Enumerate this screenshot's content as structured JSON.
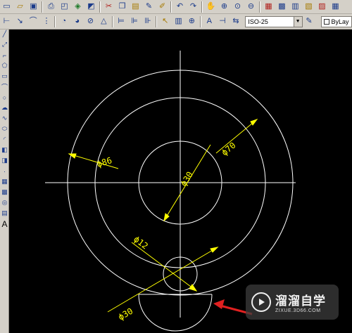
{
  "toolbar_top": {
    "icons": [
      "new-icon",
      "open-icon",
      "save-icon",
      "print-icon",
      "preview-icon",
      "publish-icon",
      "plot-icon",
      "cut-icon",
      "copy-icon",
      "paste-icon",
      "match-prop-icon",
      "block-editor-icon",
      "undo-icon",
      "redo-icon",
      "pan-icon",
      "zoom-realtime-icon",
      "zoom-window-icon",
      "zoom-previous-icon",
      "properties-icon",
      "design-center-icon",
      "tool-palettes-icon",
      "sheet-set-icon",
      "markup-icon",
      "calculator-icon"
    ]
  },
  "toolbar_dim": {
    "icons": [
      "linear-dim-icon",
      "aligned-dim-icon",
      "arc-length-icon",
      "ordinate-dim-icon",
      "radius-dim-icon",
      "jogged-dim-icon",
      "diameter-dim-icon",
      "angular-dim-icon",
      "quick-dim-icon",
      "baseline-dim-icon",
      "continue-dim-icon",
      "qleader-icon",
      "tolerance-icon",
      "center-mark-icon",
      "dimedit-icon",
      "dimtedit-icon",
      "dim-update-icon"
    ],
    "dim_style": "ISO-25",
    "layer": "ByLay"
  },
  "left_toolbar": {
    "icons": [
      "line-icon",
      "construction-line-icon",
      "polyline-icon",
      "polygon-icon",
      "rectangle-icon",
      "arc-icon",
      "circle-icon",
      "revision-cloud-icon",
      "spline-icon",
      "ellipse-icon",
      "ellipse-arc-icon",
      "insert-block-icon",
      "make-block-icon",
      "point-icon",
      "hatch-icon",
      "gradient-icon",
      "region-icon",
      "table-icon",
      "mtext-icon"
    ],
    "mtext_glyph": "A"
  },
  "drawing": {
    "dimensions": [
      "ϕ86",
      "ϕ70",
      "ϕ30",
      "ϕ12",
      "ϕ30"
    ],
    "colors": {
      "background": "#000000",
      "geometry": "#ffffff",
      "dimension": "#ffff00",
      "arrow": "#e02020"
    }
  },
  "watermark": {
    "title": "溜溜自学",
    "subtitle": "ZIXUE.3D66.COM"
  }
}
